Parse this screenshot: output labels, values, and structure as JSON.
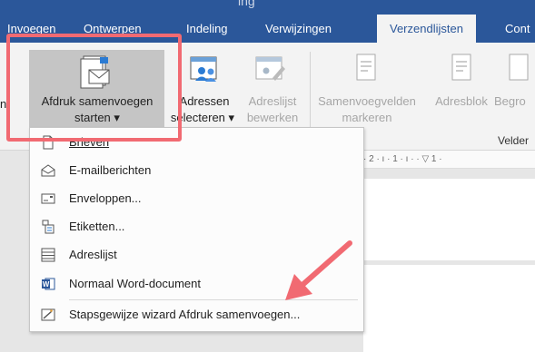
{
  "ribbon_tabs": [
    "Invoegen",
    "Ontwerpen",
    "Indeling",
    "Verwijzingen",
    "Verzendlijsten",
    "Cont"
  ],
  "active_tab_index": 4,
  "ribbon": {
    "cutoff_left_label": "n",
    "start_merge": {
      "line1": "Afdruk samenvoegen",
      "line2": "starten",
      "dropdown": "▾"
    },
    "select_recipients": {
      "line1": "Adressen",
      "line2": "selecteren",
      "dropdown": "▾"
    },
    "edit_list": {
      "line1": "Adreslijst",
      "line2": "bewerken"
    },
    "highlight_fields": {
      "line1": "Samenvoegvelden",
      "line2": "markeren"
    },
    "address_block": {
      "line1": "Adresblok"
    },
    "greeting": {
      "line1": "Begro"
    },
    "group_label": "Velder"
  },
  "ruler_text": "· 2 · ı · 1 · ı ·   · ▽ 1 ·",
  "menu": {
    "items": [
      {
        "label": "Brieven",
        "icon": "document-icon"
      },
      {
        "label": "E-mailberichten",
        "icon": "email-icon"
      },
      {
        "label": "Enveloppen...",
        "icon": "envelope-icon"
      },
      {
        "label": "Etiketten...",
        "icon": "labels-icon"
      },
      {
        "label": "Adreslijst",
        "icon": "list-icon"
      },
      {
        "label": "Normaal Word-document",
        "icon": "word-icon"
      },
      {
        "label": "Stapsgewijze wizard Afdruk samenvoegen...",
        "icon": "wizard-icon"
      }
    ]
  },
  "colors": {
    "accent": "#2b579a",
    "highlight": "#f16a72"
  }
}
